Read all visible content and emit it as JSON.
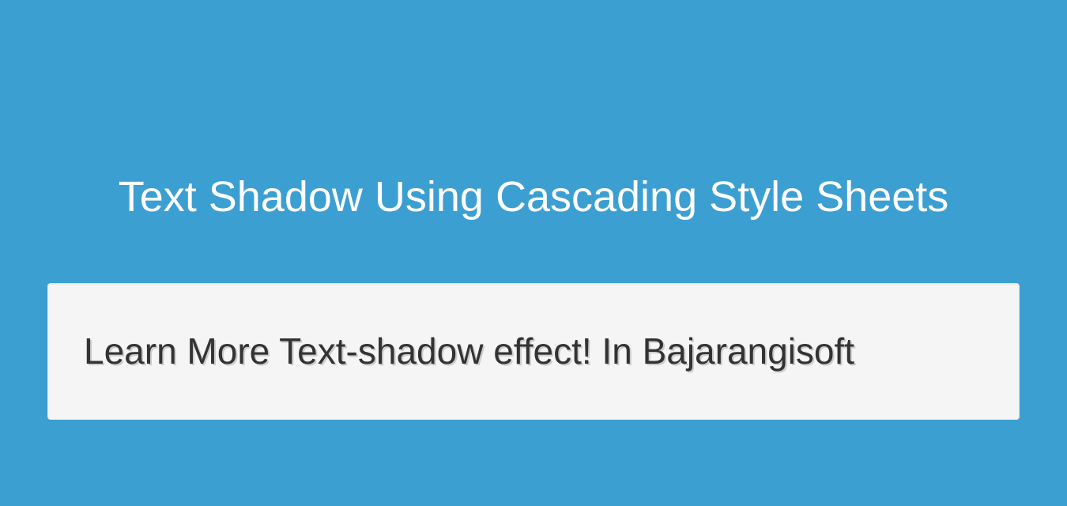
{
  "header": {
    "title": "Text Shadow Using Cascading Style Sheets"
  },
  "card": {
    "text": "Learn More Text-shadow effect! In Bajarangisoft"
  }
}
